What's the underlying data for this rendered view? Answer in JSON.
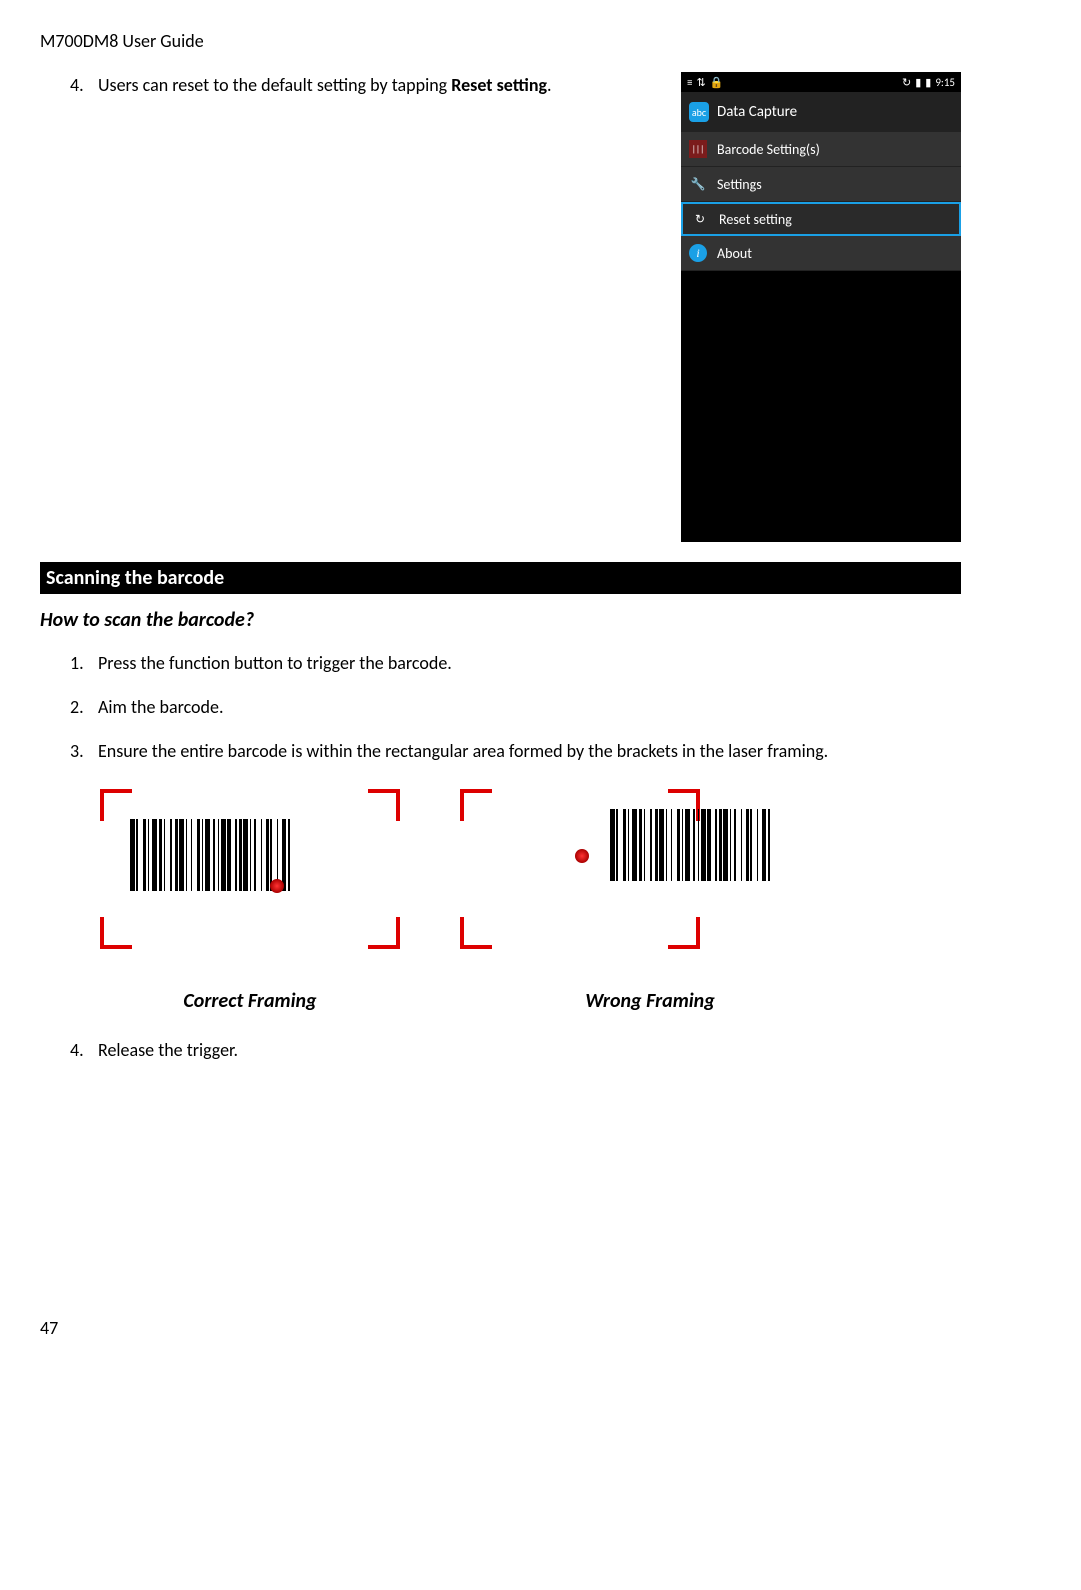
{
  "doc_header": "M700DM8 User Guide",
  "top_step": {
    "num": "4.",
    "prefix": "Users can reset to the default setting by tapping ",
    "bold": "Reset setting",
    "suffix": "."
  },
  "phone": {
    "status_time": "9:15",
    "app_title": "Data Capture",
    "menu": [
      {
        "icon": "barcode",
        "label": "Barcode Setting(s)",
        "highlight": false
      },
      {
        "icon": "settings",
        "label": "Settings",
        "highlight": false
      },
      {
        "icon": "reset",
        "label": "Reset setting",
        "highlight": true
      },
      {
        "icon": "about",
        "label": "About",
        "highlight": false
      }
    ]
  },
  "section_title": "Scanning the barcode",
  "sub_heading": "How to scan the barcode?",
  "steps": [
    {
      "num": "1.",
      "text": "Press the function button to trigger the barcode."
    },
    {
      "num": "2.",
      "text": "Aim the barcode."
    },
    {
      "num": "3.",
      "text": "Ensure the entire barcode is within the rectangular area formed by the brackets in the laser framing."
    }
  ],
  "captions": {
    "correct": "Correct Framing",
    "wrong": "Wrong Framing"
  },
  "step4": {
    "num": "4.",
    "text": "Release the trigger."
  },
  "page_number": "47"
}
